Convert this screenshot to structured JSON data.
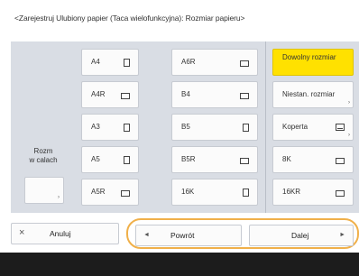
{
  "title": "<Zarejestruj Ulubiony papier (Taca wielofunkcyjna): Rozmiar papieru>",
  "inch": {
    "label_line1": "Rozm",
    "label_line2": "w calach",
    "arrow": "›"
  },
  "sizes": [
    {
      "label": "A4",
      "icon": "portrait"
    },
    {
      "label": "A4R",
      "icon": "landscape"
    },
    {
      "label": "A3",
      "icon": "portrait"
    },
    {
      "label": "A5",
      "icon": "portrait"
    },
    {
      "label": "A5R",
      "icon": "landscape"
    },
    {
      "label": "A6R",
      "icon": "landscape"
    },
    {
      "label": "B4",
      "icon": "landscape"
    },
    {
      "label": "B5",
      "icon": "portrait"
    },
    {
      "label": "B5R",
      "icon": "landscape"
    },
    {
      "label": "16K",
      "icon": "portrait"
    }
  ],
  "right_buttons": [
    {
      "label": "Dowolny rozmiar",
      "selected": true
    },
    {
      "label": "Niestan. rozmiar",
      "selected": false
    },
    {
      "label": "Koperta",
      "selected": false
    },
    {
      "label": "8K",
      "selected": false
    },
    {
      "label": "16KR",
      "selected": false
    }
  ],
  "footer": {
    "cancel": "Anuluj",
    "cancel_icon": "×",
    "back": "Powrót",
    "back_icon": "◄",
    "next": "Dalej",
    "next_icon": "►"
  },
  "colors": {
    "selected": "#ffe100",
    "nav_highlight": "#f0b04a",
    "panel": "#d9dde4"
  }
}
